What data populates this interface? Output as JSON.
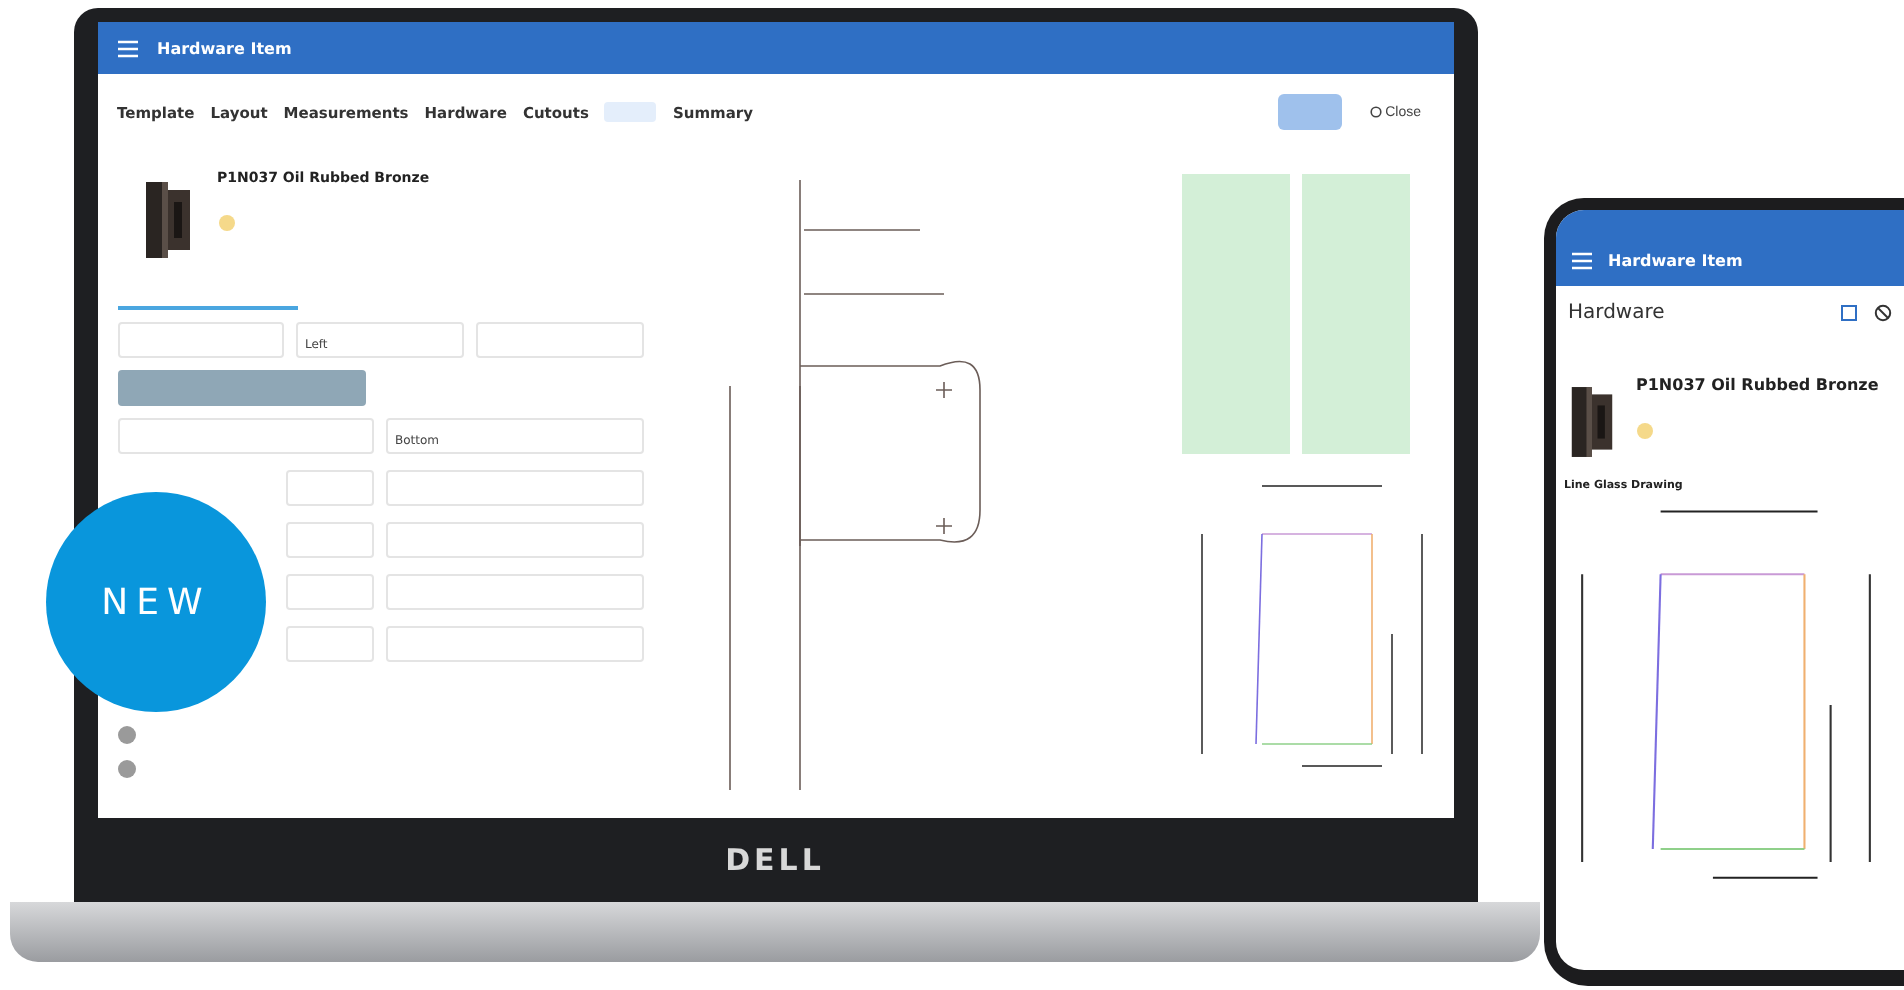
{
  "badge": {
    "text": "NEW"
  },
  "laptop": {
    "logo": "DELL",
    "app_bar": {
      "title": "Hardware Item"
    },
    "tabs": [
      {
        "label": "Template",
        "selected": false
      },
      {
        "label": "Layout",
        "selected": false
      },
      {
        "label": "Measurements",
        "selected": false
      },
      {
        "label": "Hardware",
        "selected": false
      },
      {
        "label": "Cutouts",
        "selected": false
      },
      {
        "selected": true
      },
      {
        "label": "Summary",
        "selected": false
      }
    ],
    "close_button": "Close",
    "product": {
      "name": "P1N037 Oil Rubbed Bronze"
    },
    "fields": [
      {
        "value": "Left"
      },
      {
        "value": "Bottom"
      }
    ],
    "toggles": [
      {
        "on": false
      },
      {
        "on": false
      }
    ]
  },
  "phone": {
    "app_title": "Hardware Item",
    "heading": "Hardware",
    "product": {
      "name": "P1N037 Oil Rubbed Bronze"
    },
    "drawing_title": "Line Glass Drawing"
  }
}
